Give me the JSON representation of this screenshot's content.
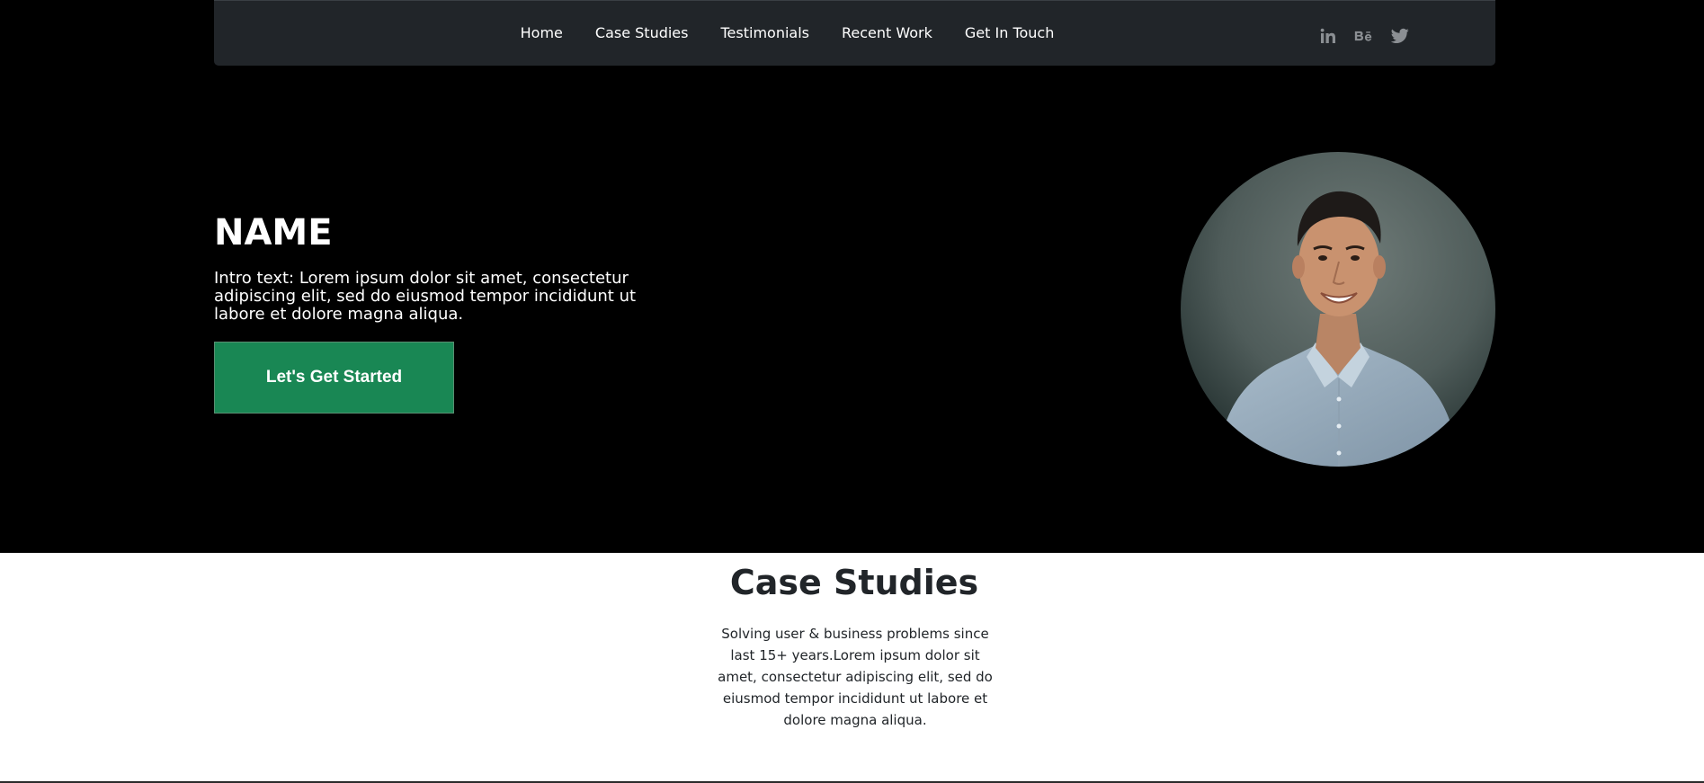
{
  "nav": {
    "links": [
      "Home",
      "Case Studies",
      "Testimonials",
      "Recent Work",
      "Get In Touch"
    ],
    "socials": [
      "linkedin-icon",
      "behance-icon",
      "twitter-icon"
    ],
    "social_labels": {
      "linkedin": "in",
      "behance": "Bē"
    }
  },
  "hero": {
    "name": "NAME",
    "intro": "Intro text: Lorem ipsum dolor sit amet, consectetur adipiscing elit, sed do eiusmod tempor incididunt ut labore et dolore magna aliqua.",
    "cta_label": "Let's Get Started"
  },
  "case_studies": {
    "title": "Case Studies",
    "description": "Solving user & business problems since last 15+ years.Lorem ipsum dolor sit amet, consectetur adipiscing elit, sed do eiusmod tempor incididunt ut labore et dolore magna aliqua."
  },
  "colors": {
    "hero_bg": "#000000",
    "nav_bg": "#212529",
    "cta_bg": "#198754",
    "icon_grey": "#8b8f93",
    "text_dark": "#212529"
  }
}
